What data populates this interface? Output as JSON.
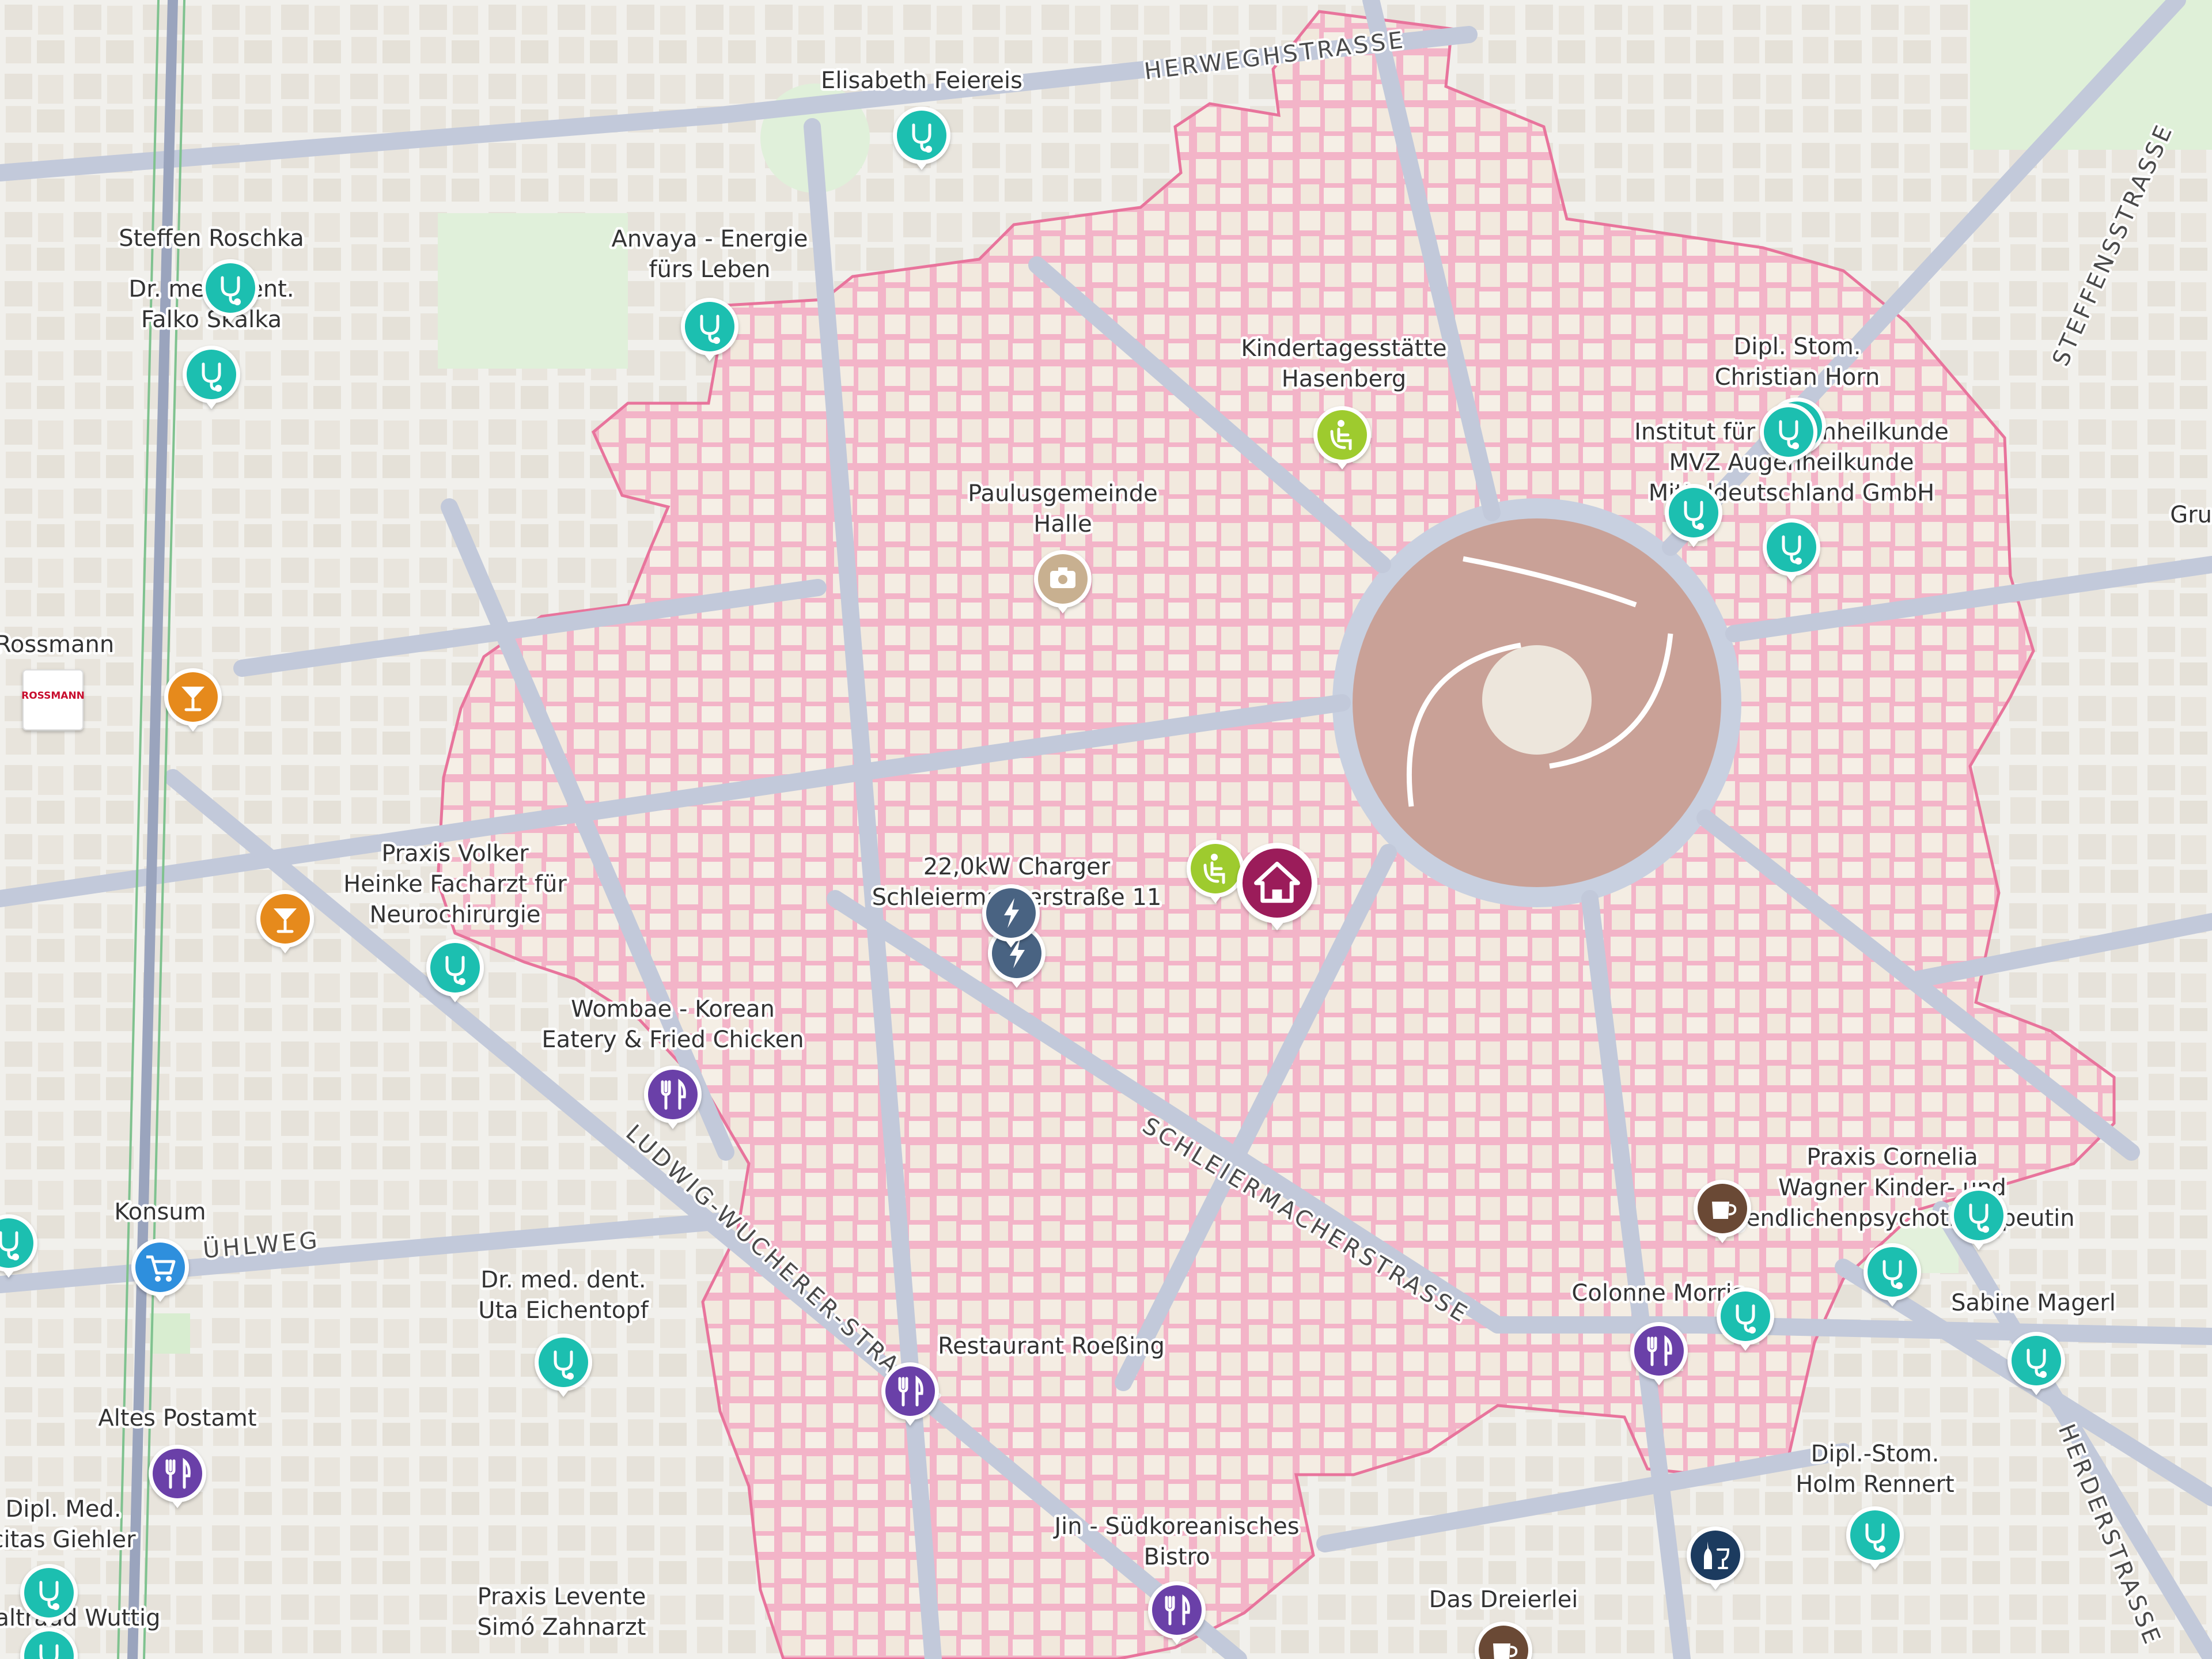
{
  "colors": {
    "area": "#f3b4c8",
    "area_border": "#e8749c",
    "park": "#c9a197",
    "medical": "#1fbfb0",
    "bar": "#e68a1a",
    "restaurant": "#6a3fa8",
    "charger": "#4a6382",
    "shop": "#2d8fdd",
    "kindergarten": "#9ecb2d",
    "church": "#c8b090",
    "cafe": "#6b4a36",
    "liquor": "#1f3a5f",
    "home": "#9b1b5a"
  },
  "streets": [
    {
      "name": "HERWEGHSTRASSE"
    },
    {
      "name": "STEFFENSSTRASSE"
    },
    {
      "name": "LUDWIG-WUCHERER-STRASSE"
    },
    {
      "name": "SCHLEIERMACHERSTRASSE"
    },
    {
      "name": "ÜHLWEG"
    },
    {
      "name": "HERDERSTRASSE"
    }
  ],
  "pois": [
    {
      "name": "elisabeth-feiereis",
      "lines": [
        "Elisabeth Feiereis"
      ],
      "icon": "stethoscope-icon",
      "color": "medical"
    },
    {
      "name": "steffen-roschka",
      "lines": [
        "Steffen Roschka"
      ],
      "icon": "stethoscope-icon",
      "color": "medical"
    },
    {
      "name": "falko-skalka",
      "lines": [
        "Dr. med. dent.",
        "Falko Skalka"
      ],
      "icon": "stethoscope-icon",
      "color": "medical"
    },
    {
      "name": "anvaya",
      "lines": [
        "Anvaya - Energie",
        "fürs Leben"
      ],
      "icon": "stethoscope-icon",
      "color": "medical"
    },
    {
      "name": "kindertagesstaette",
      "lines": [
        "Kindertagesstätte",
        "Hasenberg"
      ],
      "icon": "kindergarten-icon",
      "color": "kindergarten"
    },
    {
      "name": "christian-horn",
      "lines": [
        "Dipl. Stom.",
        "Christian Horn"
      ],
      "icon": "stethoscope-icon",
      "color": "medical"
    },
    {
      "name": "augenheilkunde",
      "lines": [
        "Institut für Augenheilkunde",
        "MVZ Augenheilkunde",
        "Mitteldeutschland GmbH"
      ],
      "icon": "stethoscope-icon",
      "color": "medical"
    },
    {
      "name": "paulusgemeinde",
      "lines": [
        "Paulusgemeinde",
        "Halle"
      ],
      "icon": "camera-icon",
      "color": "church"
    },
    {
      "name": "rossmann",
      "lines": [
        "Rossmann"
      ],
      "icon": "rossmann-logo",
      "color": "shop",
      "logo_text": "ROSSMANN"
    },
    {
      "name": "bar-1",
      "lines": [],
      "icon": "cocktail-icon",
      "color": "bar"
    },
    {
      "name": "bar-2",
      "lines": [],
      "icon": "cocktail-icon",
      "color": "bar"
    },
    {
      "name": "praxis-volker-heinke",
      "lines": [
        "Praxis Volker",
        "Heinke Facharzt für",
        "Neurochirurgie"
      ],
      "icon": "stethoscope-icon",
      "color": "medical"
    },
    {
      "name": "charger",
      "lines": [
        "22,0kW Charger",
        "Schleiermacherstraße 11"
      ],
      "icon": "lightning-icon",
      "color": "charger"
    },
    {
      "name": "kindergarten-2",
      "lines": [],
      "icon": "kindergarten-icon",
      "color": "kindergarten"
    },
    {
      "name": "home",
      "lines": [],
      "icon": "home-icon",
      "color": "home"
    },
    {
      "name": "wombae",
      "lines": [
        "Wombae - Korean",
        "Eatery & Fried Chicken"
      ],
      "icon": "restaurant-icon",
      "color": "restaurant"
    },
    {
      "name": "konsum",
      "lines": [
        "Konsum"
      ],
      "icon": "cart-icon",
      "color": "shop"
    },
    {
      "name": "uta-eichentopf",
      "lines": [
        "Dr. med. dent.",
        "Uta Eichentopf"
      ],
      "icon": "stethoscope-icon",
      "color": "medical"
    },
    {
      "name": "altes-postamt",
      "lines": [
        "Altes Postamt"
      ],
      "icon": "restaurant-icon",
      "color": "restaurant"
    },
    {
      "name": "restaurant-roessing",
      "lines": [
        "Restaurant Roeßing"
      ],
      "icon": "restaurant-icon",
      "color": "restaurant"
    },
    {
      "name": "jin",
      "lines": [
        "Jin - Südkoreanisches",
        "Bistro"
      ],
      "icon": "restaurant-icon",
      "color": "restaurant"
    },
    {
      "name": "praxis-cornelia-wagner",
      "lines": [
        "Praxis Cornelia",
        "Wagner Kinder- und",
        "Jugendlichenpsychotherapeutin"
      ],
      "icon": "cafe-icon",
      "color": "cafe"
    },
    {
      "name": "colonne-morris",
      "lines": [
        "Colonne Morris"
      ],
      "icon": "restaurant-icon",
      "color": "restaurant"
    },
    {
      "name": "sabine-magerl",
      "lines": [
        "Sabine Magerl"
      ],
      "icon": "stethoscope-icon",
      "color": "medical"
    },
    {
      "name": "holm-rennert",
      "lines": [
        "Dipl.-Stom.",
        "Holm Rennert"
      ],
      "icon": "stethoscope-icon",
      "color": "medical"
    },
    {
      "name": "das-dreierlei",
      "lines": [
        "Das Dreierlei"
      ],
      "icon": "cafe-icon",
      "color": "cafe"
    },
    {
      "name": "liquor-store",
      "lines": [],
      "icon": "wine-icon",
      "color": "liquor"
    },
    {
      "name": "citas-giehler",
      "lines": [
        "Dipl. Med.",
        "citas Giehler"
      ],
      "icon": "stethoscope-icon",
      "color": "medical"
    },
    {
      "name": "praxis-levente",
      "lines": [
        "Praxis Levente",
        "Simó Zahnarzt"
      ],
      "icon": "stethoscope-icon",
      "color": "medical"
    },
    {
      "name": "waltraud-wuttig",
      "lines": [
        "altraud Wuttig"
      ],
      "icon": "stethoscope-icon",
      "color": "medical"
    },
    {
      "name": "gru-edge",
      "lines": [
        "Gru"
      ],
      "icon": "none",
      "color": "medical"
    }
  ]
}
